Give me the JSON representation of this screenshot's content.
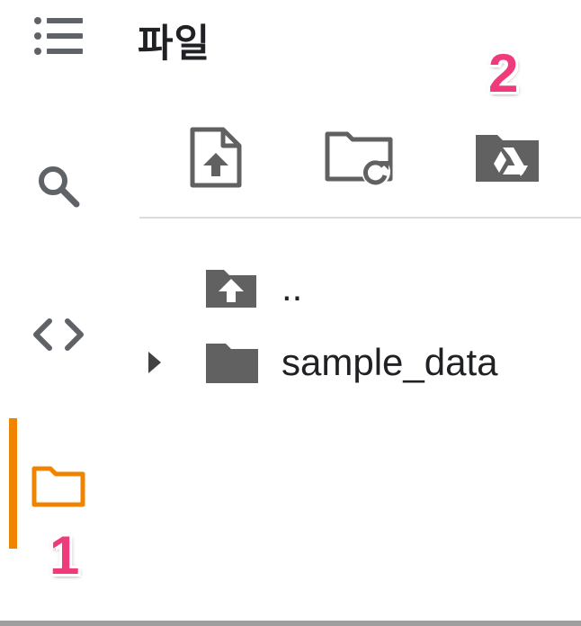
{
  "panel": {
    "title": "파일"
  },
  "sidebar": {
    "items": [
      {
        "name": "table-of-contents",
        "icon": "list-icon"
      },
      {
        "name": "find",
        "icon": "search-icon"
      },
      {
        "name": "code-snippets",
        "icon": "code-icon"
      },
      {
        "name": "files",
        "icon": "folder-icon",
        "active": true
      }
    ]
  },
  "toolbar": {
    "buttons": [
      {
        "name": "upload-file",
        "icon": "file-upload-icon"
      },
      {
        "name": "refresh",
        "icon": "folder-refresh-icon"
      },
      {
        "name": "mount-drive",
        "icon": "drive-folder-icon"
      }
    ]
  },
  "files": [
    {
      "label": "..",
      "icon": "folder-up-icon"
    },
    {
      "label": "sample_data",
      "icon": "folder-icon",
      "expandable": true
    }
  ],
  "annotations": [
    {
      "label": "1"
    },
    {
      "label": "2"
    }
  ],
  "colors": {
    "accent": "#f08400",
    "icon": "#616161",
    "annotation": "#ef3a7b"
  }
}
